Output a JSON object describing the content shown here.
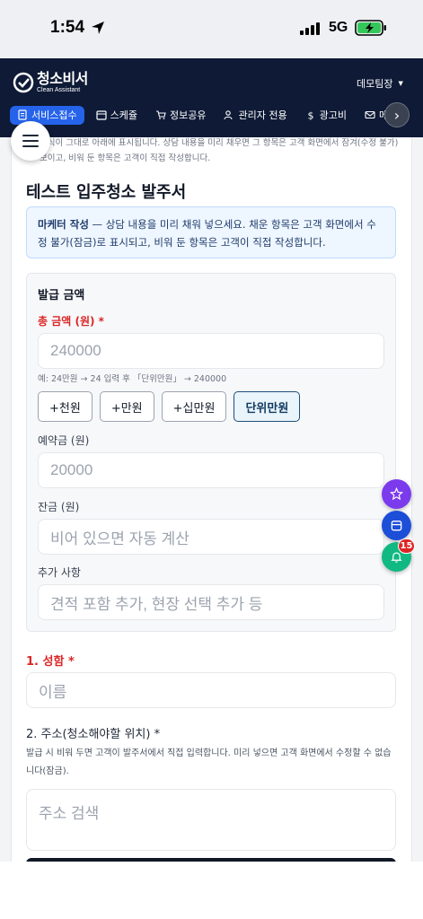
{
  "status_bar": {
    "time": "1:54",
    "network": "5G"
  },
  "header": {
    "logo_name": "청소비서",
    "logo_sub": "Clean Assistant",
    "user_menu": "데모팀장",
    "nav": [
      {
        "label": "서비스접수",
        "icon": "document-icon",
        "active": true
      },
      {
        "label": "스케쥴",
        "icon": "calendar-icon",
        "active": false
      },
      {
        "label": "정보공유",
        "icon": "cart-icon",
        "active": false
      },
      {
        "label": "관리자 전용",
        "icon": "users-icon",
        "active": false
      },
      {
        "label": "광고비",
        "icon": "dollar-icon",
        "active": false
      },
      {
        "label": "메",
        "icon": "mail-icon",
        "active": false
      }
    ]
  },
  "intro_text": "양식이 그대로 아래에 표시됩니다. 상담 내용을 미리 채우면 그 항목은 고객 화면에서 잠겨(수정 불가) 보이고, 비워 둔 항목은 고객이 직접 작성합니다.",
  "form": {
    "title": "테스트 입주청소 발주서",
    "notice_bold": "마케터 작성",
    "notice_text": " — 상담 내용을 미리 채워 넣으세요. 채운 항목은 고객 화면에서 수정 불가(잠금)로 표시되고, 비워 둔 항목은 고객이 직접 작성합니다.",
    "amount_section": {
      "title": "발급 금액",
      "total_label": "총 금액 (원) *",
      "total_placeholder": "240000",
      "total_hint": "예: 24만원 → 24 입력 후 「단위만원」 → 240000",
      "chips": [
        "+천원",
        "+만원",
        "+십만원",
        "단위만원"
      ],
      "deposit_label": "예약금 (원)",
      "deposit_placeholder": "20000",
      "balance_label": "잔금 (원)",
      "balance_placeholder": "비어 있으면 자동 계산",
      "extra_label": "추가 사항",
      "extra_placeholder": "견적 포함 추가, 현장 선택 추가 등"
    },
    "name_label": "1. 성함 *",
    "name_placeholder": "이름",
    "address_label": "2. 주소(청소해야할 위치) *",
    "address_hint": "발급 시 비워 두면 고객이 발주서에서 직접 입력합니다. 미리 넣으면 고객 화면에서 수정할 수 없습니다(잠금).",
    "address_placeholder": "주소 검색"
  },
  "floating": {
    "notification_count": "15"
  },
  "colors": {
    "header_bg": "#0e1a36",
    "accent": "#2563eb",
    "required": "#dc2626"
  }
}
